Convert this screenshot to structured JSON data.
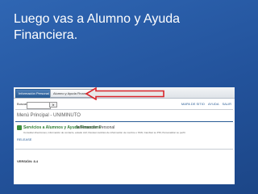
{
  "slide": {
    "title": "Luego vas a Alumno y Ayuda Financiera."
  },
  "screenshot": {
    "tabs": [
      {
        "label": "Información Personal",
        "active": true
      },
      {
        "label": "Alumno y Ayuda Financiera",
        "active": false
      }
    ],
    "search": {
      "label": "Buscar",
      "placeholder": "",
      "button_label": "Ir"
    },
    "top_links": [
      "MAPA DE SITIO",
      "AYUDA",
      "SALIR"
    ],
    "menu_title": "Menú Principal - UNIMINUTO",
    "card": {
      "icon": "folder-icon",
      "title": "Servicios a Alumnos y Ayuda Financiera",
      "subtitle": "Información Personal",
      "description": "Consultar direcciones, información de contacto, estado civil; Revisar cambios de información de nombre o SSN; Cambiar su PIN; Personalizar su perfil.",
      "link": "RELEASE"
    },
    "version": "VERSIÓN: 8.4"
  },
  "colors": {
    "slide_bg": "#2a5ca8",
    "arrow_outline": "#d9262c",
    "tab_active": "#2a5d96",
    "card_title": "#2e7d32"
  }
}
